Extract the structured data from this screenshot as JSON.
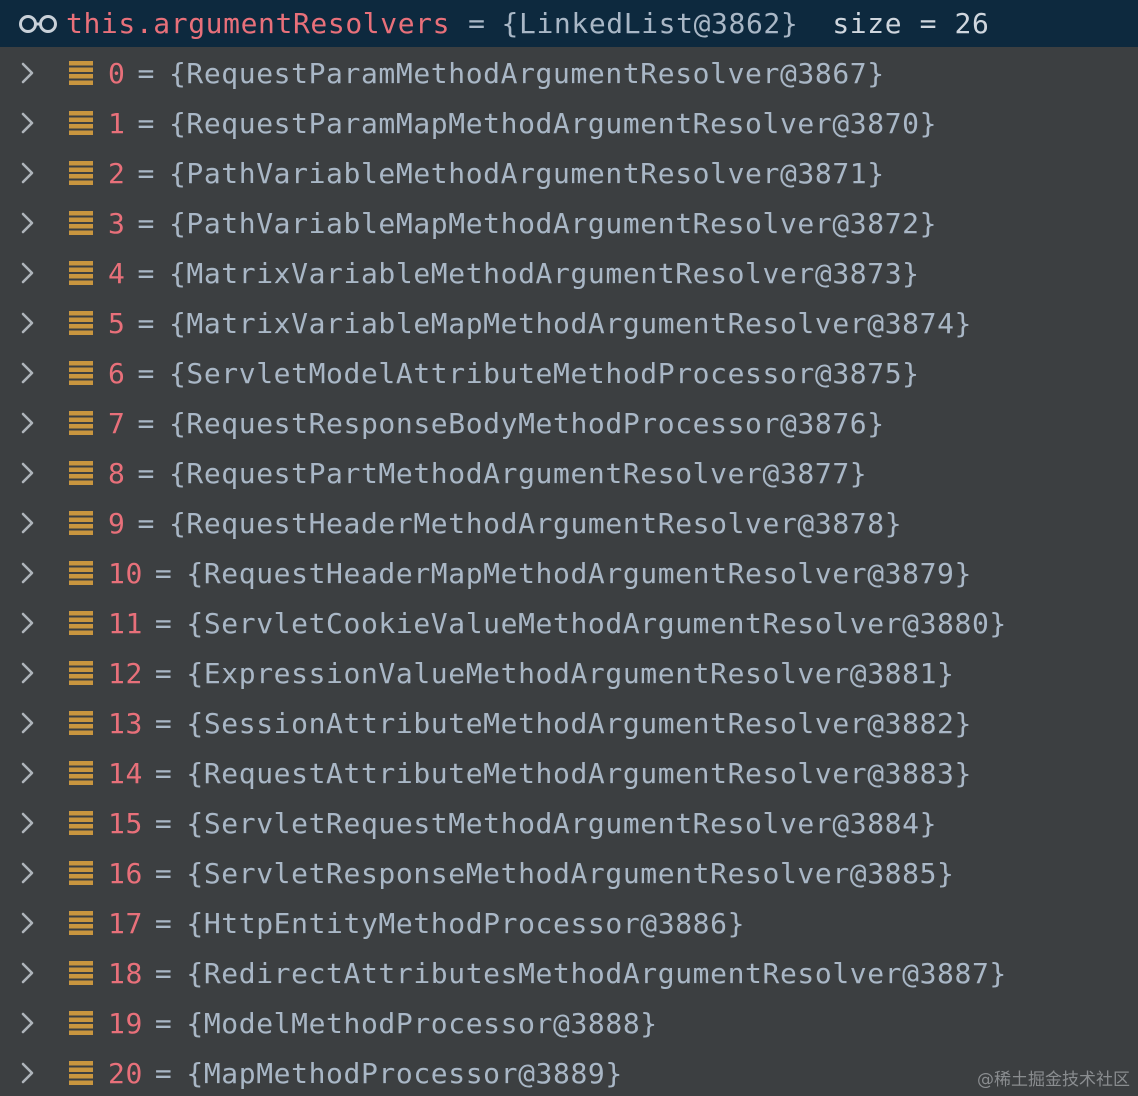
{
  "header": {
    "icon": "watch-icon",
    "variable": "this.argumentResolvers",
    "equals": "=",
    "value": "{LinkedList@3862}",
    "size_text": "size = 26"
  },
  "items": [
    {
      "index": "0",
      "value": "{RequestParamMethodArgumentResolver@3867}"
    },
    {
      "index": "1",
      "value": "{RequestParamMapMethodArgumentResolver@3870}"
    },
    {
      "index": "2",
      "value": "{PathVariableMethodArgumentResolver@3871}"
    },
    {
      "index": "3",
      "value": "{PathVariableMapMethodArgumentResolver@3872}"
    },
    {
      "index": "4",
      "value": "{MatrixVariableMethodArgumentResolver@3873}"
    },
    {
      "index": "5",
      "value": "{MatrixVariableMapMethodArgumentResolver@3874}"
    },
    {
      "index": "6",
      "value": "{ServletModelAttributeMethodProcessor@3875}"
    },
    {
      "index": "7",
      "value": "{RequestResponseBodyMethodProcessor@3876}"
    },
    {
      "index": "8",
      "value": "{RequestPartMethodArgumentResolver@3877}"
    },
    {
      "index": "9",
      "value": "{RequestHeaderMethodArgumentResolver@3878}"
    },
    {
      "index": "10",
      "value": "{RequestHeaderMapMethodArgumentResolver@3879}"
    },
    {
      "index": "11",
      "value": "{ServletCookieValueMethodArgumentResolver@3880}"
    },
    {
      "index": "12",
      "value": "{ExpressionValueMethodArgumentResolver@3881}"
    },
    {
      "index": "13",
      "value": "{SessionAttributeMethodArgumentResolver@3882}"
    },
    {
      "index": "14",
      "value": "{RequestAttributeMethodArgumentResolver@3883}"
    },
    {
      "index": "15",
      "value": "{ServletRequestMethodArgumentResolver@3884}"
    },
    {
      "index": "16",
      "value": "{ServletResponseMethodArgumentResolver@3885}"
    },
    {
      "index": "17",
      "value": "{HttpEntityMethodProcessor@3886}"
    },
    {
      "index": "18",
      "value": "{RedirectAttributesMethodArgumentResolver@3887}"
    },
    {
      "index": "19",
      "value": "{ModelMethodProcessor@3888}"
    },
    {
      "index": "20",
      "value": "{MapMethodProcessor@3889}"
    }
  ],
  "row_equals": "=",
  "icons": {
    "expand": "chevron-right-icon",
    "field": "field-icon"
  },
  "colors": {
    "background": "#3c3f41",
    "header_background": "#0d293e",
    "name_color": "#e8707a",
    "value_color": "#a9b7c6",
    "field_icon_color": "#c9963f"
  },
  "watermark": "@稀土掘金技术社区"
}
